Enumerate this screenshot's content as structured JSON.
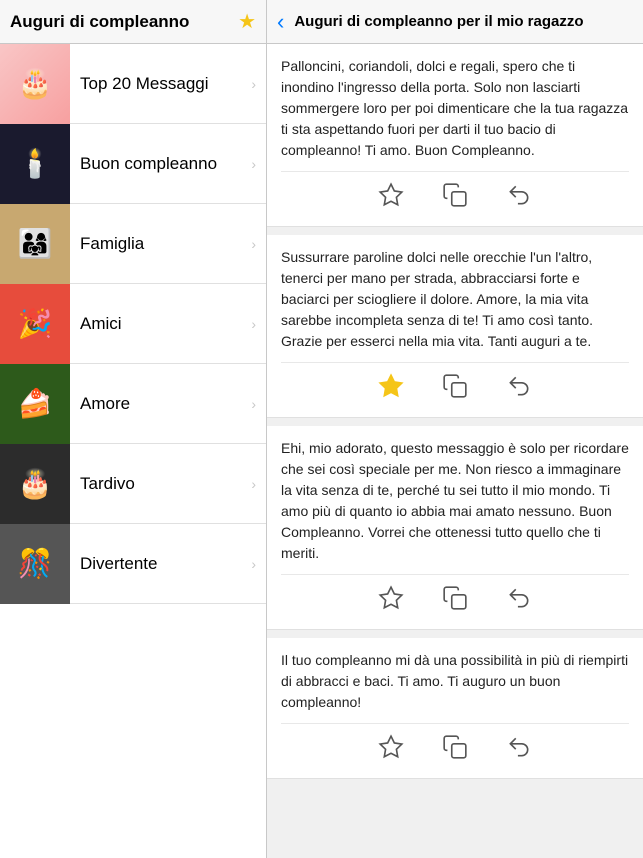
{
  "header": {
    "left_title": "Auguri di compleanno",
    "star_icon": "★",
    "back_icon": "‹",
    "right_title": "Auguri di compleanno per il mio ragazzo"
  },
  "sidebar": {
    "items": [
      {
        "id": "top20",
        "label": "Top 20 Messaggi",
        "thumb_class": "thumb-top20",
        "emoji": "🎂"
      },
      {
        "id": "buon",
        "label": "Buon compleanno",
        "thumb_class": "thumb-candles",
        "emoji": "🕯️"
      },
      {
        "id": "famiglia",
        "label": "Famiglia",
        "thumb_class": "thumb-people",
        "emoji": "👨‍👩‍👧"
      },
      {
        "id": "amici",
        "label": "Amici",
        "thumb_class": "thumb-party",
        "emoji": "🎉"
      },
      {
        "id": "amore",
        "label": "Amore",
        "thumb_class": "thumb-food",
        "emoji": "🍰"
      },
      {
        "id": "tardivo",
        "label": "Tardivo",
        "thumb_class": "thumb-dark-cake",
        "emoji": "🎂"
      },
      {
        "id": "divertente",
        "label": "Divertente",
        "thumb_class": "thumb-bw",
        "emoji": "🎊"
      }
    ],
    "chevron": "›"
  },
  "messages": [
    {
      "id": 1,
      "text": "Palloncini, coriandoli, dolci e regali, spero che ti inondino l'ingresso della porta. Solo non lasciarti sommergere loro per poi dimenticare che la tua ragazza ti sta aspettando fuori per darti il tuo bacio di compleanno! Ti amo. Buon Compleanno.",
      "starred": false
    },
    {
      "id": 2,
      "text": "Sussurrare paroline dolci nelle orecchie l'un l'altro, tenerci per mano per strada, abbracciarsi forte e baciarci per sciogliere il dolore. Amore, la mia vita sarebbe incompleta senza di te! Ti amo così tanto. Grazie per esserci nella mia vita. Tanti auguri a te.",
      "starred": true
    },
    {
      "id": 3,
      "text": "Ehi, mio adorato, questo messaggio è solo per ricordare che sei così speciale per me. Non riesco a immaginare la vita senza di te, perché tu sei tutto il mio mondo. Ti amo più di quanto io abbia mai amato nessuno. Buon Compleanno. Vorrei che ottenessi tutto quello che ti meriti.",
      "starred": false
    },
    {
      "id": 4,
      "text": "Il tuo compleanno mi dà una possibilità in più di riempirti di abbracci e baci. Ti amo. Ti auguro un buon compleanno!",
      "starred": false
    }
  ],
  "icons": {
    "star_empty": "☆",
    "star_filled": "★",
    "copy": "⎘",
    "share": "↩"
  }
}
